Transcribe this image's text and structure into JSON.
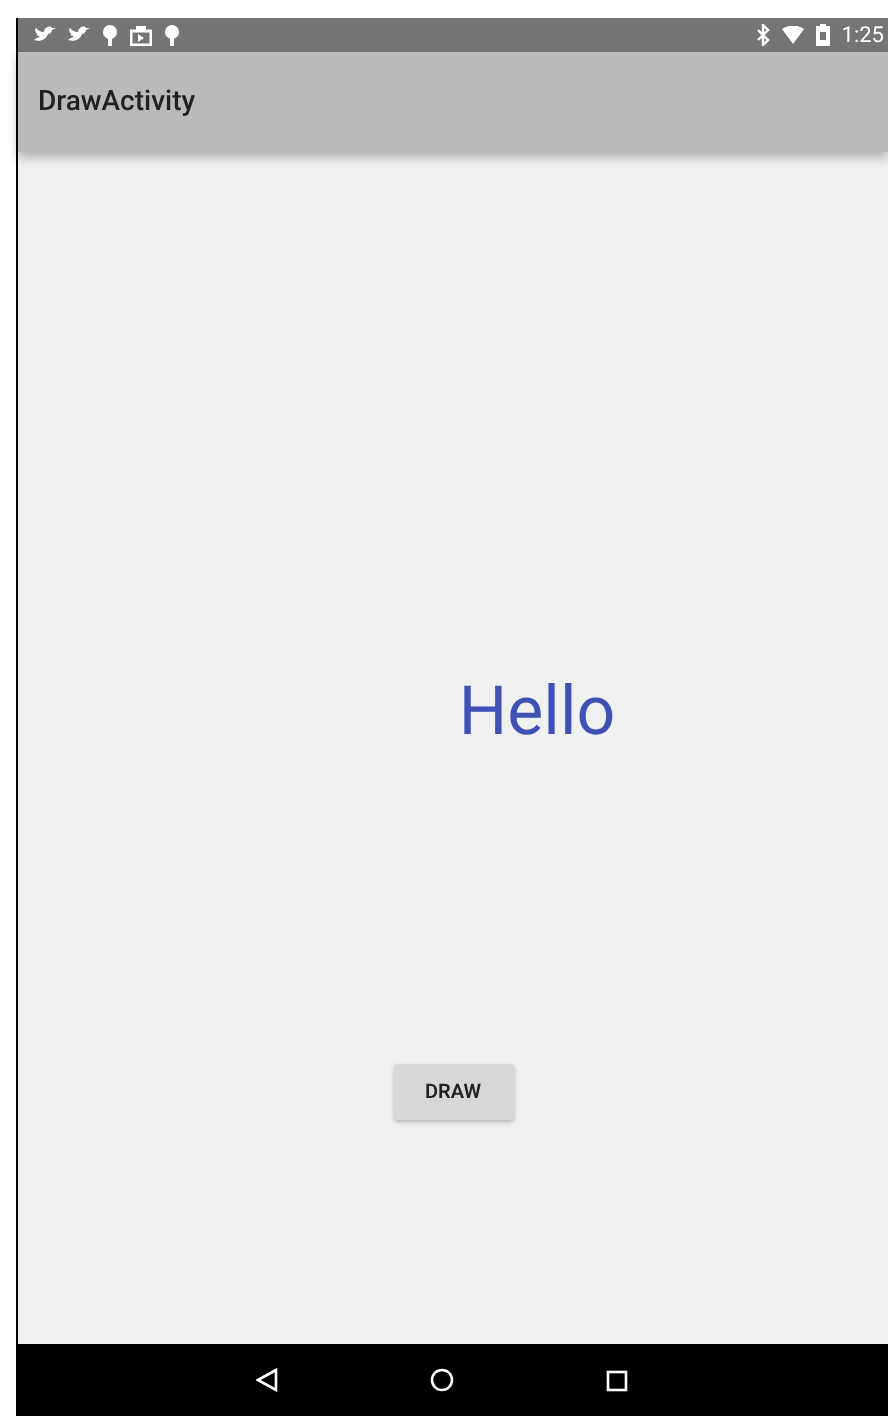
{
  "status_bar": {
    "time": "1:25"
  },
  "app_bar": {
    "title": "DrawActivity"
  },
  "content": {
    "greeting": "Hello",
    "button": "DRAW"
  }
}
